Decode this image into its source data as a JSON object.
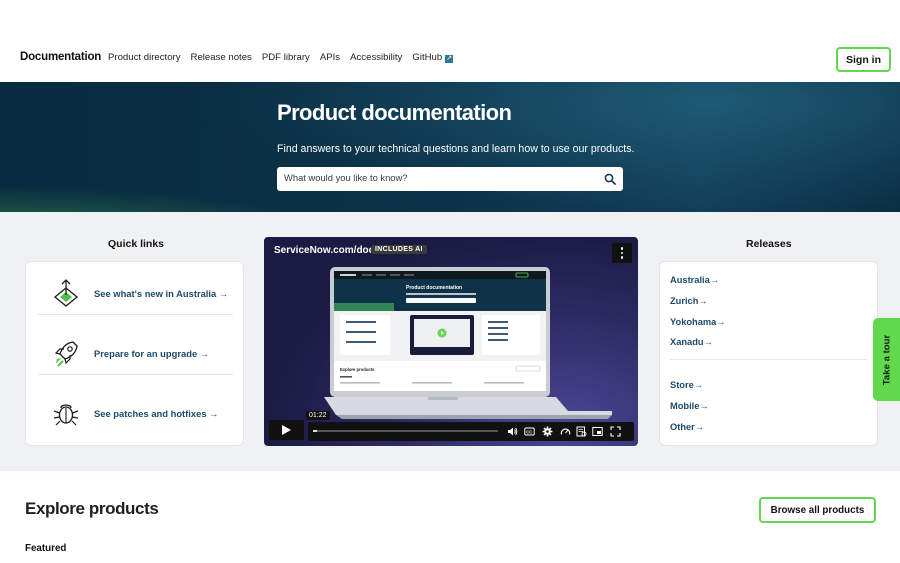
{
  "nav": {
    "brand": "Documentation",
    "links": [
      "Product directory",
      "Release notes",
      "PDF library",
      "APIs",
      "Accessibility",
      "GitHub"
    ],
    "sign_in": "Sign in"
  },
  "hero": {
    "title": "Product documentation",
    "subtitle": "Find answers to your technical questions and learn how to use our products.",
    "search_placeholder": "What would you like to know?"
  },
  "quick_links": {
    "title": "Quick links",
    "items": [
      {
        "label": "See what's new in Australia",
        "icon": "release-diamond-icon"
      },
      {
        "label": "Prepare for an upgrade",
        "icon": "rocket-icon"
      },
      {
        "label": "See patches and hotfixes",
        "icon": "bug-icon"
      }
    ]
  },
  "video": {
    "title": "ServiceNow.com/docs",
    "badge": "INCLUDES AI",
    "time": "01:22",
    "progress": 0.02,
    "screen_title": "Product documentation",
    "screen_section": "Explore products"
  },
  "releases": {
    "title": "Releases",
    "versions": [
      "Australia",
      "Zurich",
      "Yokohama",
      "Xanadu"
    ],
    "other": [
      "Store",
      "Mobile",
      "Other"
    ]
  },
  "tour": {
    "label": "Take a tour"
  },
  "explore": {
    "title": "Explore products",
    "browse": "Browse all products",
    "featured": "Featured"
  },
  "colors": {
    "accent_green": "#62d84e",
    "link_blue": "#1d4a6b",
    "hero_dark": "#082c3f"
  }
}
